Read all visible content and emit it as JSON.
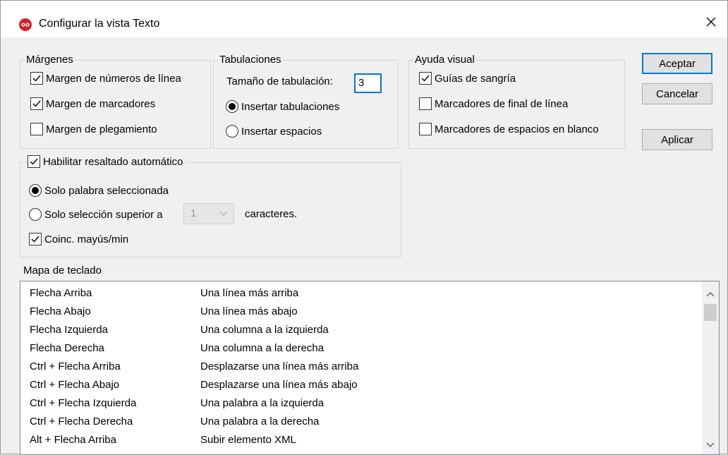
{
  "window": {
    "title": "Configurar la vista Texto"
  },
  "margins": {
    "legend": "Márgenes",
    "items": [
      {
        "label": "Margen de números de línea",
        "checked": true
      },
      {
        "label": "Margen de marcadores",
        "checked": true
      },
      {
        "label": "Margen de plegamiento",
        "checked": false
      }
    ]
  },
  "tabs": {
    "legend": "Tabulaciones",
    "size_label": "Tamaño de tabulación:",
    "size_value": "3",
    "options": [
      {
        "label": "Insertar tabulaciones",
        "selected": true
      },
      {
        "label": "Insertar espacios",
        "selected": false
      }
    ]
  },
  "visual_aid": {
    "legend": "Ayuda visual",
    "items": [
      {
        "label": "Guías de sangría",
        "checked": true
      },
      {
        "label": "Marcadores de final de línea",
        "checked": false
      },
      {
        "label": "Marcadores de espacios en blanco",
        "checked": false
      }
    ]
  },
  "buttons": {
    "ok": "Aceptar",
    "cancel": "Cancelar",
    "apply": "Aplicar"
  },
  "highlight": {
    "enable_label": "Habilitar resaltado automático",
    "enabled": true,
    "option_word": "Solo palabra seleccionada",
    "option_selection": "Solo selección superior a",
    "min_chars_value": "1",
    "chars_suffix": "caracteres.",
    "case_label": "Coinc. mayús/min",
    "case_checked": true
  },
  "keymap": {
    "title": "Mapa de teclado",
    "rows": [
      {
        "key": "Flecha Arriba",
        "action": "Una línea más arriba"
      },
      {
        "key": "Flecha Abajo",
        "action": "Una línea más abajo"
      },
      {
        "key": "Flecha Izquierda",
        "action": "Una columna a la izquierda"
      },
      {
        "key": "Flecha Derecha",
        "action": "Una columna a la derecha"
      },
      {
        "key": "Ctrl + Flecha Arriba",
        "action": "Desplazarse una línea más arriba"
      },
      {
        "key": "Ctrl + Flecha Abajo",
        "action": "Desplazarse una línea más abajo"
      },
      {
        "key": "Ctrl + Flecha Izquierda",
        "action": "Una palabra a la izquierda"
      },
      {
        "key": "Ctrl + Flecha Derecha",
        "action": "Una palabra a la derecha"
      },
      {
        "key": "Alt + Flecha Arriba",
        "action": "Subir elemento XML"
      }
    ]
  },
  "colors": {
    "accent": "#0078d7",
    "app_icon": "#d6202f"
  }
}
